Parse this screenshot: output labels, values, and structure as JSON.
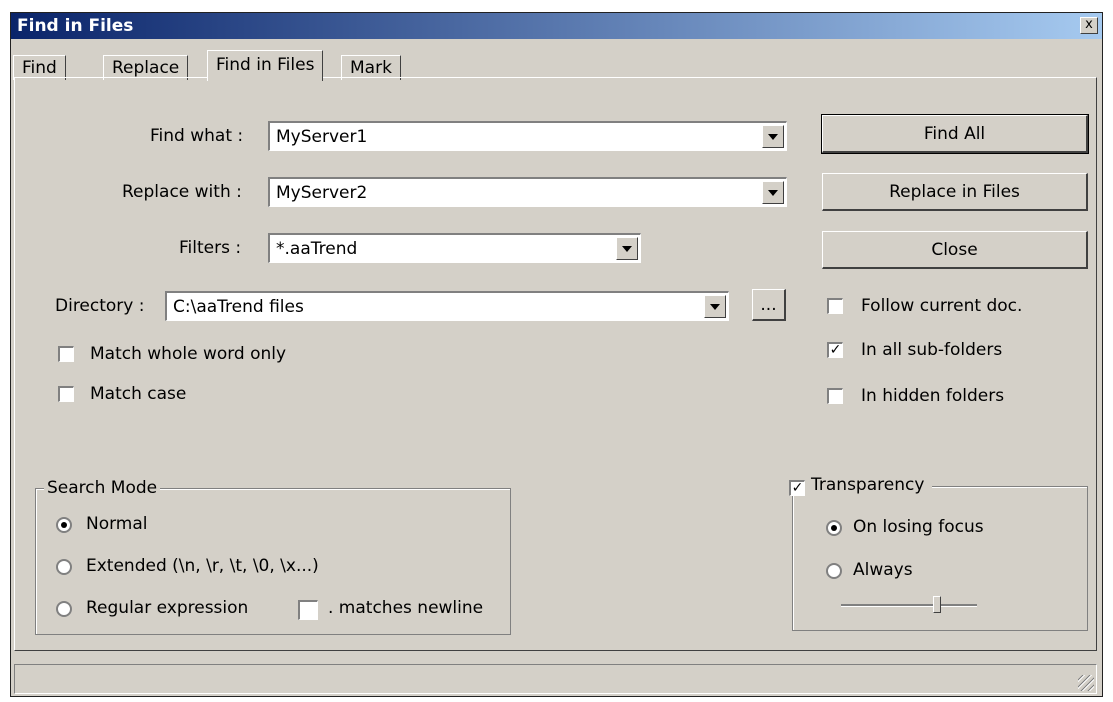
{
  "window": {
    "title": "Find in Files",
    "close_symbol": "x"
  },
  "tabs": [
    {
      "label": "Find"
    },
    {
      "label": "Replace"
    },
    {
      "label": "Find in Files",
      "active": true
    },
    {
      "label": "Mark"
    }
  ],
  "fields": {
    "find_what": {
      "label": "Find what :",
      "value": "MyServer1"
    },
    "replace_with": {
      "label": "Replace with :",
      "value": "MyServer2"
    },
    "filters": {
      "label": "Filters :",
      "value": "*.aaTrend"
    },
    "directory": {
      "label": "Directory :",
      "value": "C:\\aaTrend files",
      "browse_label": "..."
    }
  },
  "buttons": {
    "find_all": "Find All",
    "replace_in_files": "Replace in Files",
    "close": "Close"
  },
  "options": {
    "follow_current_doc": {
      "label": "Follow current doc.",
      "checked": false
    },
    "in_all_sub_folders": {
      "label": "In all sub-folders",
      "checked": true
    },
    "in_hidden_folders": {
      "label": "In hidden folders",
      "checked": false
    },
    "match_whole_word": {
      "label": "Match whole word only",
      "checked": false
    },
    "match_case": {
      "label": "Match case",
      "checked": false
    }
  },
  "search_mode": {
    "title": "Search Mode",
    "normal": "Normal",
    "extended": "Extended (\\n, \\r, \\t, \\0, \\x...)",
    "regex": "Regular expression",
    "matches_newline": ". matches newline",
    "selected": "normal"
  },
  "transparency": {
    "title": "Transparency",
    "checked": true,
    "on_losing_focus": "On losing focus",
    "always": "Always",
    "selected": "on_losing_focus",
    "slider_level": 0.72
  },
  "colors": {
    "titlebar_start": "#0a246a",
    "titlebar_end": "#a6caf0",
    "face": "#d4d0c8"
  }
}
